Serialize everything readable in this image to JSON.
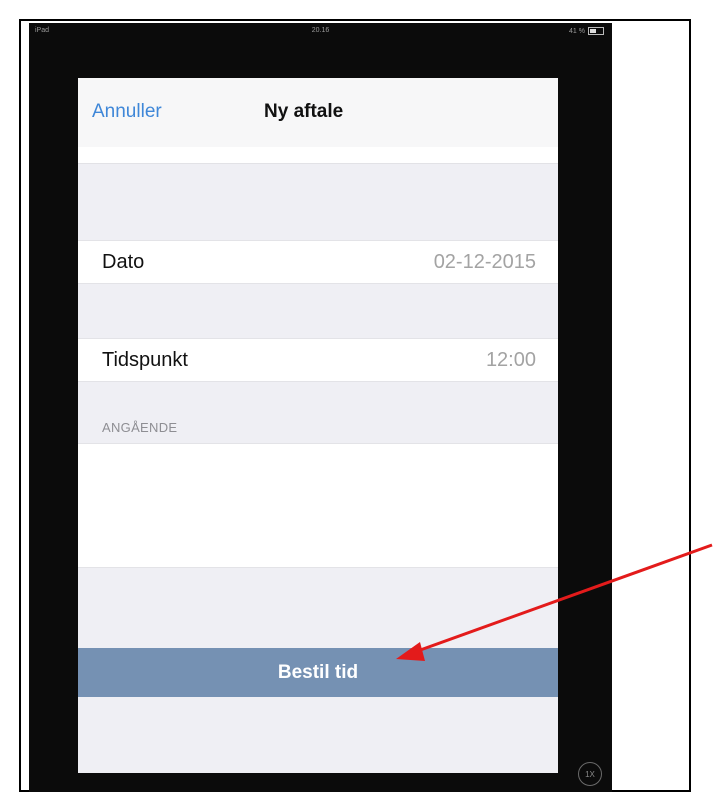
{
  "status_bar": {
    "carrier": "iPad",
    "time": "20.16",
    "battery": "41 %"
  },
  "navbar": {
    "cancel_label": "Annuller",
    "title": "Ny aftale"
  },
  "form": {
    "date_label": "Dato",
    "date_value": "02-12-2015",
    "time_label": "Tidspunkt",
    "time_value": "12:00",
    "notes_header": "ANGÅENDE",
    "notes_value": ""
  },
  "book_button_label": "Bestil tid",
  "zoom_button_label": "1X",
  "colors": {
    "accent": "#3f87d8",
    "button": "#7591b3",
    "annotation_arrow": "#e31b1b"
  }
}
